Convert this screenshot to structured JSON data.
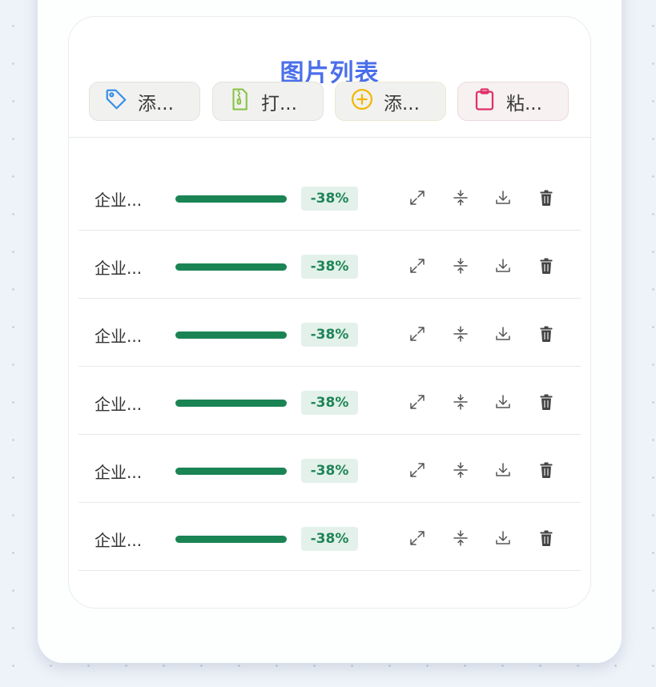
{
  "panel": {
    "title": "图片列表"
  },
  "toolbar": [
    {
      "label": "添...",
      "icon": "tag-icon",
      "color": "#3b8fe6"
    },
    {
      "label": "打...",
      "icon": "zip-file-icon",
      "color": "#8bc34a"
    },
    {
      "label": "添...",
      "icon": "plus-circle-icon",
      "color": "#f2b705"
    },
    {
      "label": "粘...",
      "icon": "clipboard-icon",
      "color": "#e0306a"
    }
  ],
  "files": [
    {
      "name": "企业...",
      "progress": 1.0,
      "change": "-38%"
    },
    {
      "name": "企业...",
      "progress": 1.0,
      "change": "-38%"
    },
    {
      "name": "企业...",
      "progress": 1.0,
      "change": "-38%"
    },
    {
      "name": "企业...",
      "progress": 1.0,
      "change": "-38%"
    },
    {
      "name": "企业...",
      "progress": 1.0,
      "change": "-38%"
    },
    {
      "name": "企业...",
      "progress": 1.0,
      "change": "-38%"
    }
  ],
  "row_actions": [
    "expand-icon",
    "compress-icon",
    "download-icon",
    "trash-icon"
  ],
  "colors": {
    "accent": "#4b6fe9",
    "progress": "#1b8454",
    "badge_bg": "#e3f1ea",
    "badge_text": "#1e8556"
  }
}
